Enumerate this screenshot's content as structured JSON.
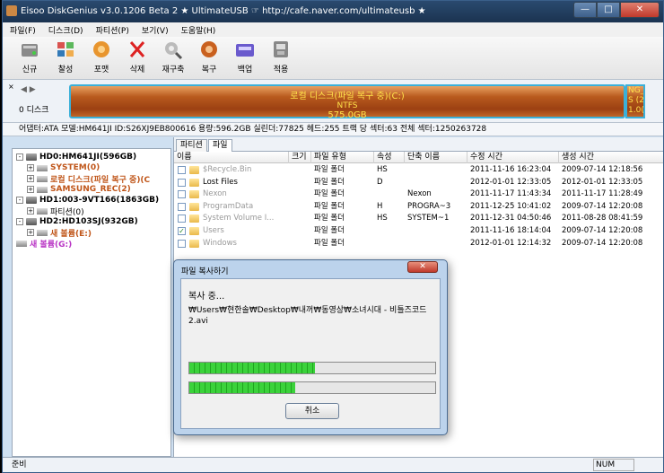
{
  "window": {
    "title": "Eisoo DiskGenius v3.0.1206 Beta 2  ★ UltimateUSB  ☞ http://cafe.naver.com/ultimateusb ★",
    "min": "—",
    "max": "□",
    "close": "✕"
  },
  "menu": [
    "파일(F)",
    "디스크(D)",
    "파티션(P)",
    "보기(V)",
    "도움말(H)"
  ],
  "toolbar": [
    {
      "label": "신규",
      "icon": "new-disk-icon"
    },
    {
      "label": "찰성",
      "icon": "grid-icon"
    },
    {
      "label": "포맷",
      "icon": "format-icon"
    },
    {
      "label": "삭제",
      "icon": "delete-icon"
    },
    {
      "label": "재구축",
      "icon": "rebuild-icon"
    },
    {
      "label": "복구",
      "icon": "recover-icon"
    },
    {
      "label": "백업",
      "icon": "backup-icon"
    },
    {
      "label": "적용",
      "icon": "apply-icon"
    }
  ],
  "diskmap": {
    "close": "×",
    "arrows": "◀ ▶",
    "disk_label": "0 디스크",
    "part_name": "로컬 디스크(파일 복구 중)(C:)",
    "part_fs": "NTFS",
    "part_size": "575.0GB",
    "side_l1": "NG_",
    "side_l2": "S (2",
    "side_l3": "1.0("
  },
  "infobar": "어댑터:ATA  모델:HM641JI  ID:S26XJ9EB800616  용량:596.2GB  실린더:77825  헤드:255  트랙 당 섹터:63  전체 섹터:1250263728",
  "tree": [
    {
      "label": "HD0:HM641JI(596GB)",
      "bold": true,
      "color": "",
      "level": 0,
      "pm": "-",
      "kind": "hdd"
    },
    {
      "label": "SYSTEM(0)",
      "bold": true,
      "color": "orange",
      "level": 1,
      "pm": "+",
      "kind": "vol"
    },
    {
      "label": "로컬 디스크(파일 복구 중)(C",
      "bold": true,
      "color": "orange",
      "level": 1,
      "pm": "+",
      "kind": "vol"
    },
    {
      "label": "SAMSUNG_REC(2)",
      "bold": true,
      "color": "orange",
      "level": 1,
      "pm": "+",
      "kind": "vol"
    },
    {
      "label": "HD1:003-9VT166(1863GB)",
      "bold": true,
      "color": "",
      "level": 0,
      "pm": "-",
      "kind": "hdd"
    },
    {
      "label": "파티션(0)",
      "bold": false,
      "color": "",
      "level": 1,
      "pm": "+",
      "kind": "vol"
    },
    {
      "label": "HD2:HD103SJ(932GB)",
      "bold": true,
      "color": "",
      "level": 0,
      "pm": "-",
      "kind": "hdd"
    },
    {
      "label": "새 볼륨(E:)",
      "bold": true,
      "color": "orange",
      "level": 1,
      "pm": "+",
      "kind": "vol"
    },
    {
      "label": "새 볼륨(G:)",
      "bold": true,
      "color": "purple",
      "level": 0,
      "pm": "",
      "kind": "vol"
    }
  ],
  "tabs": [
    "파티션",
    "파일"
  ],
  "columns": [
    "이름",
    "크기",
    "파일 유형",
    "속성",
    "단축 이름",
    "수정 시간",
    "생성 시간"
  ],
  "files": [
    {
      "name": "$Recycle.Bin",
      "size": "",
      "type": "파일 폴더",
      "attr": "HS",
      "short": "",
      "mtime": "2011-11-16 16:23:04",
      "ctime": "2009-07-14 12:18:56",
      "gray": true,
      "checked": false
    },
    {
      "name": "Lost Files",
      "size": "",
      "type": "파일 폴더",
      "attr": "D",
      "short": "",
      "mtime": "2012-01-01 12:33:05",
      "ctime": "2012-01-01 12:33:05",
      "gray": false,
      "checked": false
    },
    {
      "name": "Nexon",
      "size": "",
      "type": "파일 폴더",
      "attr": "",
      "short": "Nexon",
      "mtime": "2011-11-17 11:43:34",
      "ctime": "2011-11-17 11:28:49",
      "gray": true,
      "checked": false
    },
    {
      "name": "ProgramData",
      "size": "",
      "type": "파일 폴더",
      "attr": "H",
      "short": "PROGRA~3",
      "mtime": "2011-12-25 10:41:02",
      "ctime": "2009-07-14 12:20:08",
      "gray": true,
      "checked": false
    },
    {
      "name": "System Volume I...",
      "size": "",
      "type": "파일 폴더",
      "attr": "HS",
      "short": "SYSTEM~1",
      "mtime": "2011-12-31 04:50:46",
      "ctime": "2011-08-28 08:41:59",
      "gray": true,
      "checked": false
    },
    {
      "name": "Users",
      "size": "",
      "type": "파일 폴더",
      "attr": "",
      "short": "",
      "mtime": "2011-11-16 18:14:04",
      "ctime": "2009-07-14 12:20:08",
      "gray": true,
      "checked": true
    },
    {
      "name": "Windows",
      "size": "",
      "type": "파일 폴더",
      "attr": "",
      "short": "",
      "mtime": "2012-01-01 12:14:32",
      "ctime": "2009-07-14 12:20:08",
      "gray": true,
      "checked": false
    }
  ],
  "dialog": {
    "title": "파일 복사하기",
    "close": "✕",
    "status": "복사 중...",
    "path": "₩Users₩현한솔₩Desktop₩내꺼₩동영상₩소녀시대 - 비틀즈코드2.avi",
    "progress_file": 0.51,
    "progress_total": 0.43,
    "cancel": "취소"
  },
  "status": {
    "left": "준비",
    "num": "NUM"
  }
}
